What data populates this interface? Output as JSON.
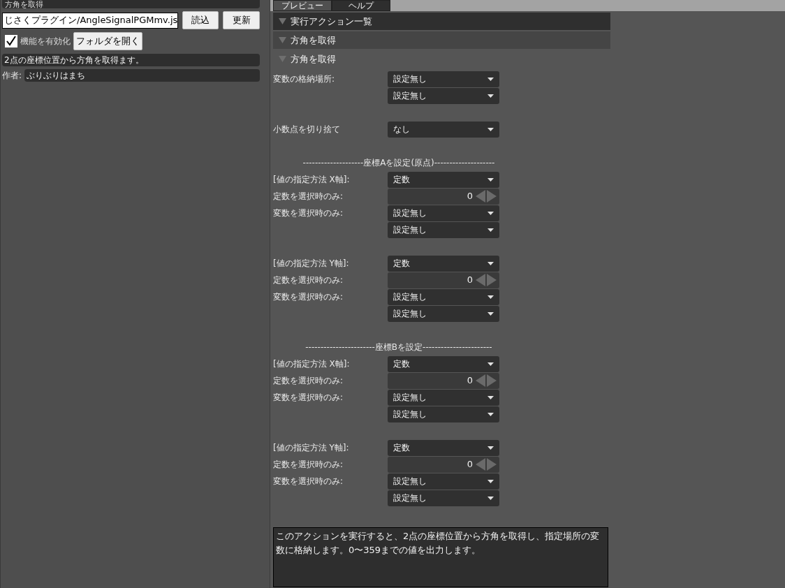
{
  "left_panel": {
    "title": "方角を取得",
    "file_path": "じさくプラグイン/AngleSignalPGMmv.js",
    "load_button": "読込",
    "update_button": "更新",
    "enable": {
      "label": "機能を有効化",
      "checked": true
    },
    "open_folder_button": "フォルダを開く",
    "description": "2点の座標位置から方角を取得ます。",
    "author_label": "作者:",
    "author": "ぶりぶりはまち"
  },
  "tabs": [
    {
      "label": "プレビュー",
      "selected": true
    },
    {
      "label": "ヘルプ",
      "selected": false
    }
  ],
  "headers": [
    {
      "label": "実行アクション一覧",
      "kind": "dark"
    },
    {
      "label": "方角を取得",
      "kind": "mid"
    },
    {
      "label": "方角を取得",
      "kind": "plain"
    }
  ],
  "form": [
    {
      "kind": "select",
      "label": "変数の格納場所:",
      "value": "設定無し"
    },
    {
      "kind": "select",
      "value": "設定無し"
    },
    {
      "kind": "spacer"
    },
    {
      "kind": "select",
      "label": "小数点を切り捨て",
      "value": "なし"
    },
    {
      "kind": "spacer"
    },
    {
      "kind": "divider",
      "text": "--------------------座標Aを設定(原点)--------------------"
    },
    {
      "kind": "select",
      "label": "[値の指定方法 X軸]:",
      "value": "定数"
    },
    {
      "kind": "number",
      "label": "定数を選択時のみ:",
      "value": "0"
    },
    {
      "kind": "select",
      "label": "変数を選択時のみ:",
      "value": "設定無し"
    },
    {
      "kind": "select",
      "value": "設定無し"
    },
    {
      "kind": "spacer"
    },
    {
      "kind": "select",
      "label": "[値の指定方法 Y軸]:",
      "value": "定数"
    },
    {
      "kind": "number",
      "label": "定数を選択時のみ:",
      "value": "0"
    },
    {
      "kind": "select",
      "label": "変数を選択時のみ:",
      "value": "設定無し"
    },
    {
      "kind": "select",
      "value": "設定無し"
    },
    {
      "kind": "spacer"
    },
    {
      "kind": "divider",
      "text": "-----------------------座標Bを設定-----------------------"
    },
    {
      "kind": "select",
      "label": "[値の指定方法 X軸]:",
      "value": "定数"
    },
    {
      "kind": "number",
      "label": "定数を選択時のみ:",
      "value": "0"
    },
    {
      "kind": "select",
      "label": "変数を選択時のみ:",
      "value": "設定無し"
    },
    {
      "kind": "select",
      "value": "設定無し"
    },
    {
      "kind": "spacer"
    },
    {
      "kind": "select",
      "label": "[値の指定方法 Y軸]:",
      "value": "定数"
    },
    {
      "kind": "number",
      "label": "定数を選択時のみ:",
      "value": "0"
    },
    {
      "kind": "select",
      "label": "変数を選択時のみ:",
      "value": "設定無し"
    },
    {
      "kind": "select",
      "value": "設定無し"
    }
  ],
  "help_text": "このアクションを実行すると、2点の座標位置から方角を取得し、指定場所の変数に格納します。0〜359までの値を出力します。"
}
